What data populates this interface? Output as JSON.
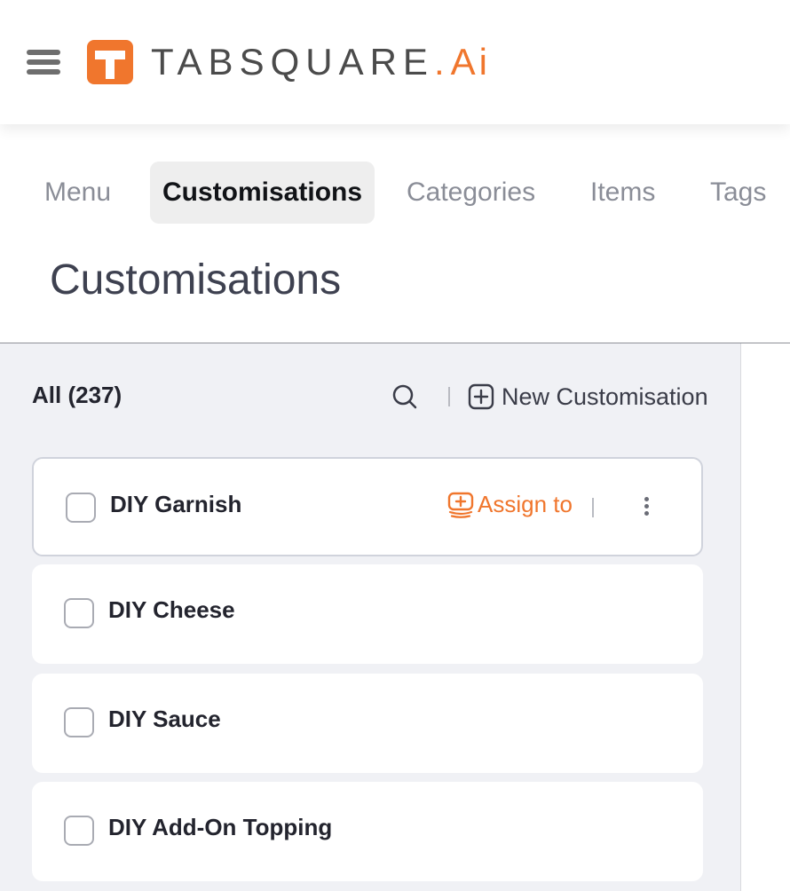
{
  "header": {
    "menu_icon": "hamburger-icon",
    "logo": {
      "wordmark": "TABSQUARE",
      "dot": ".",
      "suffix": "Ai",
      "brand_color": "#f0762d"
    }
  },
  "tabs": [
    {
      "label": "Menu",
      "active": false
    },
    {
      "label": "Customisations",
      "active": true
    },
    {
      "label": "Categories",
      "active": false
    },
    {
      "label": "Items",
      "active": false
    },
    {
      "label": "Tags",
      "active": false
    }
  ],
  "page": {
    "title": "Customisations"
  },
  "list": {
    "filter_label": "All (237)",
    "search_icon": "search-icon",
    "new_button_label": "New Customisation",
    "items": [
      {
        "name": "DIY Garnish",
        "assign_label": "Assign to",
        "highlighted": true
      },
      {
        "name": "DIY Cheese"
      },
      {
        "name": "DIY Sauce"
      },
      {
        "name": "DIY Add-On Topping"
      }
    ]
  },
  "colors": {
    "accent": "#f0762d",
    "panel_bg": "#f0f1f5",
    "text_dark": "#23242e"
  }
}
